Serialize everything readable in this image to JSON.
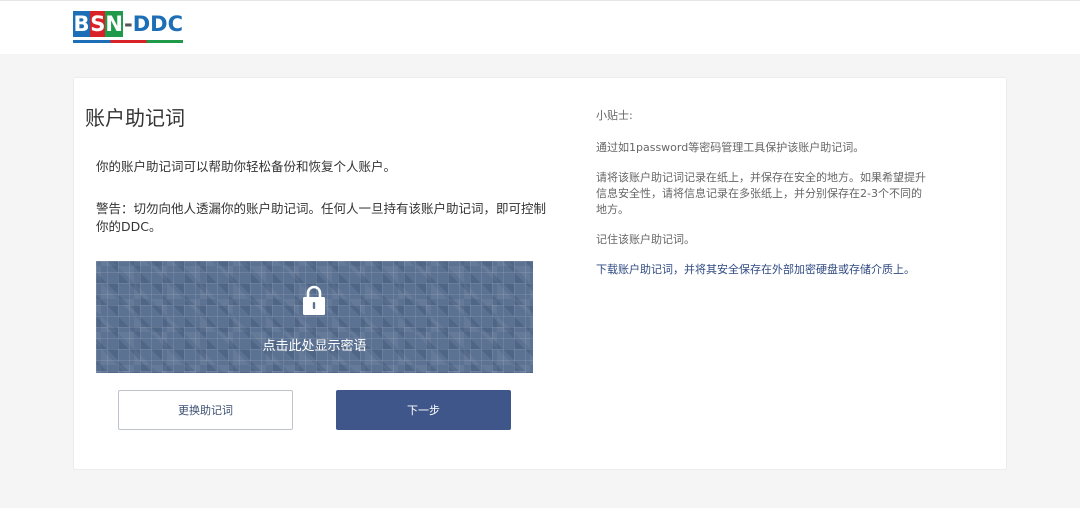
{
  "logo": {
    "b": "B",
    "s": "S",
    "n": "N",
    "dash": "-",
    "rest": "DDC"
  },
  "page": {
    "title": "账户助记词",
    "description": "你的账户助记词可以帮助你轻松备份和恢复个人账户。",
    "warning": "警告：切勿向他人透漏你的账户助记词。任何人一旦持有该账户助记词，即可控制你的DDC。"
  },
  "reveal": {
    "label": "点击此处显示密语",
    "icon": "lock-icon",
    "color": "#5b7292"
  },
  "buttons": {
    "change": "更换助记词",
    "next": "下一步",
    "primary_color": "#3e5689"
  },
  "tips": {
    "title": "小贴士:",
    "items": [
      "通过如1password等密码管理工具保护该账户助记词。",
      "请将该账户助记词记录在纸上，并保存在安全的地方。如果希望提升信息安全性，请将信息记录在多张纸上，并分别保存在2-3个不同的地方。",
      "记住该账户助记词。"
    ],
    "download_link": "下载账户助记词，并将其安全保存在外部加密硬盘或存储介质上。"
  }
}
